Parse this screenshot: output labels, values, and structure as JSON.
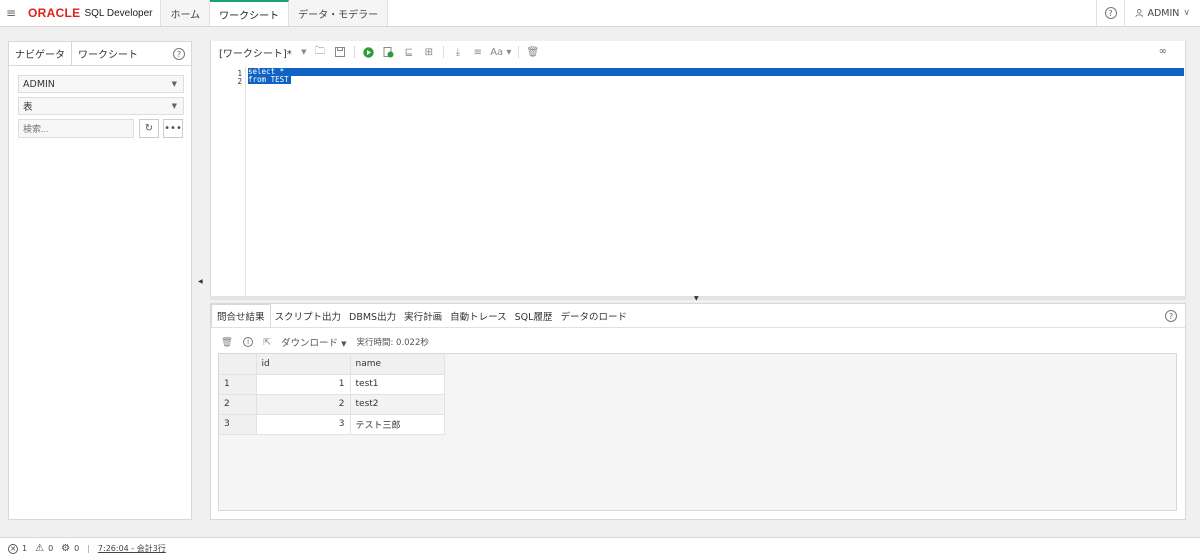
{
  "topbar": {
    "menu_icon": "hamburger-icon",
    "logo_oracle": "ORACLE",
    "logo_product": "SQL Developer",
    "tabs": [
      {
        "label": "ホーム",
        "active": false
      },
      {
        "label": "ワークシート",
        "active": true
      },
      {
        "label": "データ・モデラー",
        "active": false
      }
    ],
    "help_icon": "help-icon",
    "user_label": "ADMIN"
  },
  "navigator": {
    "tabs": [
      {
        "label": "ナビゲータ",
        "active": true
      },
      {
        "label": "ワークシート",
        "active": false
      }
    ],
    "schema_select": "ADMIN",
    "object_type_select": "表",
    "search_placeholder": "検索..."
  },
  "editor": {
    "worksheet_title": "[ワークシート]*",
    "lines": [
      {
        "number": "1",
        "text": "select *"
      },
      {
        "number": "2",
        "text": "from TEST"
      }
    ]
  },
  "results": {
    "tabs": [
      {
        "label": "問合せ結果",
        "active": true
      },
      {
        "label": "スクリプト出力",
        "active": false
      },
      {
        "label": "DBMS出力",
        "active": false
      },
      {
        "label": "実行計画",
        "active": false
      },
      {
        "label": "自動トレース",
        "active": false
      },
      {
        "label": "SQL履歴",
        "active": false
      },
      {
        "label": "データのロード",
        "active": false
      }
    ],
    "download_label": "ダウンロード",
    "exec_time": "実行時間: 0.022秒",
    "columns": [
      "id",
      "name"
    ],
    "rows": [
      {
        "row": "1",
        "id": "1",
        "name": "test1"
      },
      {
        "row": "2",
        "id": "2",
        "name": "test2"
      },
      {
        "row": "3",
        "id": "3",
        "name": "テスト三郎"
      }
    ]
  },
  "statusbar": {
    "errors": "1",
    "warnings": "0",
    "tasks": "0",
    "separator": "|",
    "last_action": "7:26:04 - 会計3行"
  },
  "colors": {
    "oracle_red": "#e0201b",
    "active_tab_accent": "#1aa36a",
    "selection_blue": "#1063c4",
    "run_green": "#2a9d3a"
  }
}
